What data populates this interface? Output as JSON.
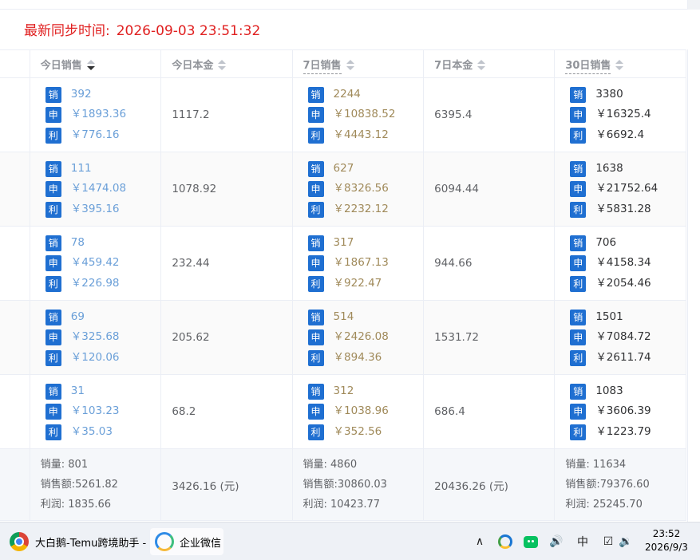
{
  "sync": {
    "label": "最新同步时间:",
    "value": "2026-09-03 23:51:32"
  },
  "columns": [
    {
      "label": "今日销售",
      "sortable": true,
      "active_desc": true,
      "dashed": false
    },
    {
      "label": "今日本金",
      "sortable": true,
      "active_desc": false,
      "dashed": false
    },
    {
      "label": "7日销售",
      "sortable": true,
      "active_desc": false,
      "dashed": true
    },
    {
      "label": "7日本金",
      "sortable": true,
      "active_desc": false,
      "dashed": false
    },
    {
      "label": "30日销售",
      "sortable": true,
      "active_desc": false,
      "dashed": true
    }
  ],
  "badges": {
    "sales": "销",
    "amount": "申",
    "profit": "利"
  },
  "rows": [
    {
      "today": {
        "sales": "392",
        "amount": "￥1893.36",
        "profit": "￥776.16"
      },
      "today_cost": "1117.2",
      "week": {
        "sales": "2244",
        "amount": "￥10838.52",
        "profit": "￥4443.12"
      },
      "week_cost": "6395.4",
      "month": {
        "sales": "3380",
        "amount": "￥16325.4",
        "profit": "￥6692.4"
      }
    },
    {
      "today": {
        "sales": "111",
        "amount": "￥1474.08",
        "profit": "￥395.16"
      },
      "today_cost": "1078.92",
      "week": {
        "sales": "627",
        "amount": "￥8326.56",
        "profit": "￥2232.12"
      },
      "week_cost": "6094.44",
      "month": {
        "sales": "1638",
        "amount": "￥21752.64",
        "profit": "￥5831.28"
      }
    },
    {
      "today": {
        "sales": "78",
        "amount": "￥459.42",
        "profit": "￥226.98"
      },
      "today_cost": "232.44",
      "week": {
        "sales": "317",
        "amount": "￥1867.13",
        "profit": "￥922.47"
      },
      "week_cost": "944.66",
      "month": {
        "sales": "706",
        "amount": "￥4158.34",
        "profit": "￥2054.46"
      }
    },
    {
      "today": {
        "sales": "69",
        "amount": "￥325.68",
        "profit": "￥120.06"
      },
      "today_cost": "205.62",
      "week": {
        "sales": "514",
        "amount": "￥2426.08",
        "profit": "￥894.36"
      },
      "week_cost": "1531.72",
      "month": {
        "sales": "1501",
        "amount": "￥7084.72",
        "profit": "￥2611.74"
      }
    },
    {
      "today": {
        "sales": "31",
        "amount": "￥103.23",
        "profit": "￥35.03"
      },
      "today_cost": "68.2",
      "week": {
        "sales": "312",
        "amount": "￥1038.96",
        "profit": "￥352.56"
      },
      "week_cost": "686.4",
      "month": {
        "sales": "1083",
        "amount": "￥3606.39",
        "profit": "￥1223.79"
      }
    }
  ],
  "summary": {
    "today": {
      "qty": "销量: 801",
      "amount": "销售额:5261.82",
      "profit": "利润: 1835.66"
    },
    "today_cost": "3426.16 (元)",
    "week": {
      "qty": "销量: 4860",
      "amount": "销售额:30860.03",
      "profit": "利润: 10423.77"
    },
    "week_cost": "20436.26 (元)",
    "month": {
      "qty": "销量: 11634",
      "amount": "销售额:79376.60",
      "profit": "利润: 25245.70"
    }
  },
  "taskbar": {
    "chrome_title": "大白鹅-Temu跨境助手 -",
    "wecom_title": "企业微信",
    "tray": {
      "chevron": "∧",
      "volume": "🔊",
      "ime": "中",
      "pen": "☑",
      "speaker": "🔉"
    },
    "time": "23:52",
    "date": "2026/9/3"
  },
  "colors": {
    "accent_red": "#e02020",
    "badge_blue": "#1f6fd1",
    "today_value": "#6a9fd8",
    "week_value": "#a08a5a"
  }
}
